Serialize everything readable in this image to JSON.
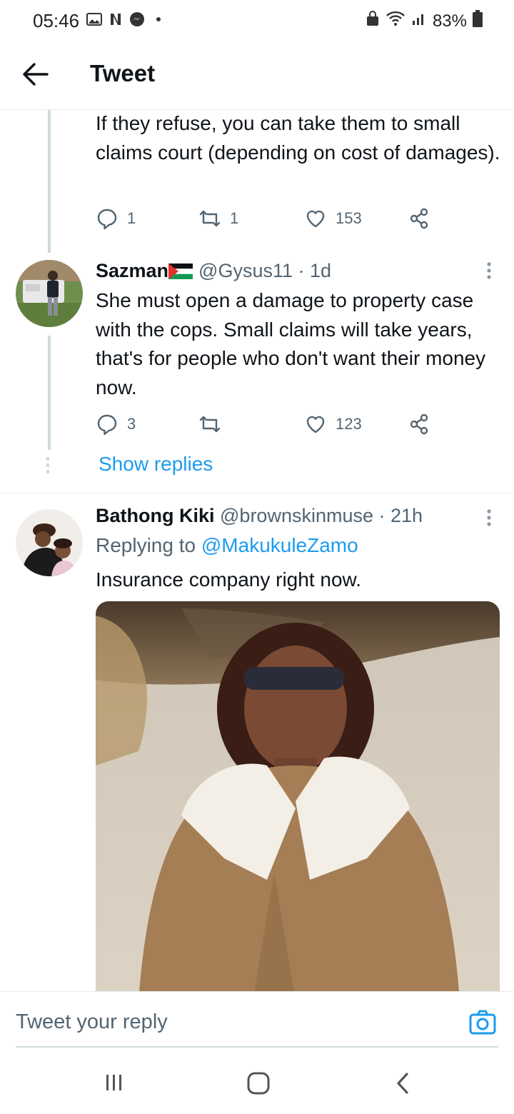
{
  "status_bar": {
    "time": "05:46",
    "battery": "83%"
  },
  "header": {
    "title": "Tweet"
  },
  "parent_tweet": {
    "text": "If they refuse, you can take them to small claims court (depending on cost of damages).",
    "replies": "1",
    "retweets": "1",
    "likes": "153"
  },
  "tweet_sazman": {
    "name": "Sazman",
    "handle": "@Gysus11",
    "time": "· 1d",
    "text": "She must open a  damage to property case with the cops. Small claims will take years, that's for people who don't want their money now.",
    "replies": "3",
    "retweets": "",
    "likes": "123"
  },
  "show_replies": "Show replies",
  "tweet_kiki": {
    "name": "Bathong Kiki",
    "handle": "@brownskinmuse",
    "time": "· 21h",
    "replying_prefix": "Replying to",
    "replying_to": "@MakukuleZamo",
    "text": "Insurance company right now."
  },
  "composer": {
    "placeholder": "Tweet your reply"
  },
  "colors": {
    "accent": "#1d9bf0",
    "text_primary": "#0f1419",
    "text_secondary": "#536471"
  },
  "icons": [
    "gallery-icon",
    "netflix-icon",
    "messenger-icon",
    "back-arrow-icon",
    "reply-icon",
    "retweet-icon",
    "like-icon",
    "share-icon",
    "more-icon",
    "camera-icon",
    "recents-icon",
    "home-icon",
    "back-nav-icon"
  ]
}
